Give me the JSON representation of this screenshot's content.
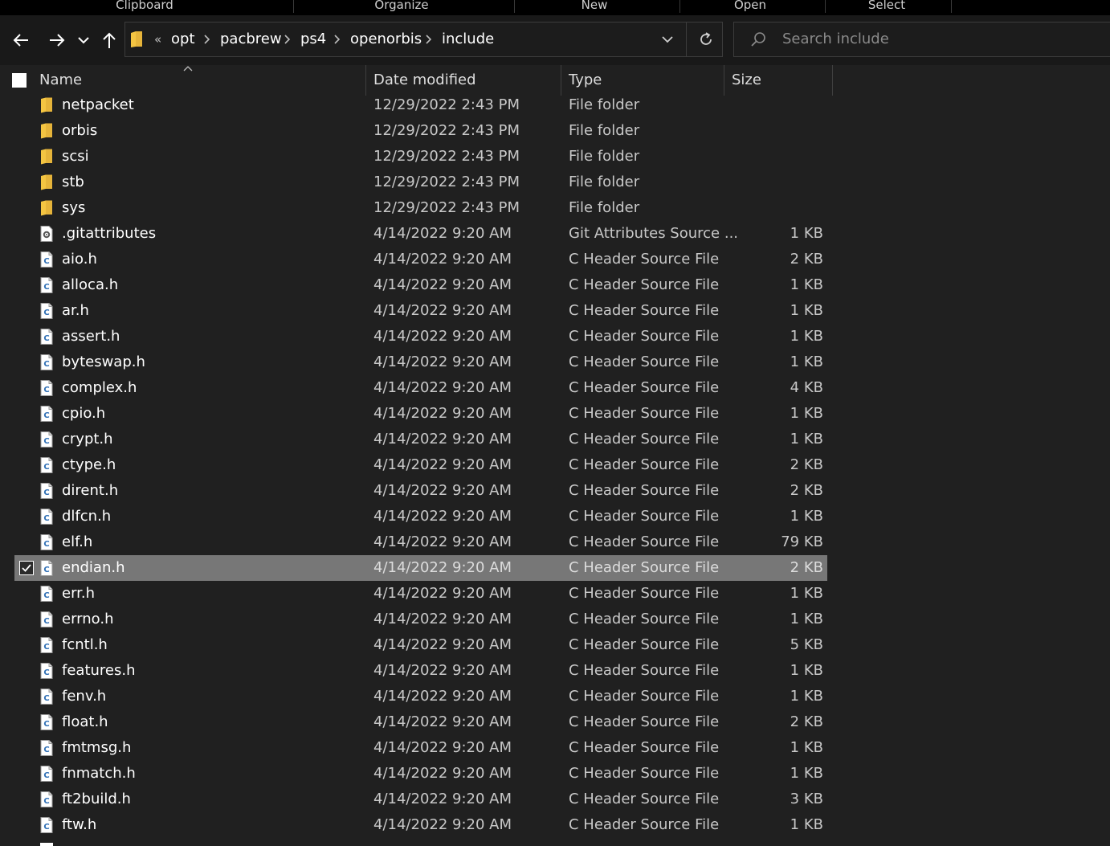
{
  "ribbon": {
    "groups": [
      "Clipboard",
      "Organize",
      "New",
      "Open",
      "Select"
    ]
  },
  "nav": {
    "back_icon": "arrow-left-icon",
    "forward_icon": "arrow-right-icon",
    "recent_icon": "chevron-down-icon",
    "up_icon": "arrow-up-icon",
    "path_overflow": "«",
    "path": [
      "opt",
      "pacbrew",
      "ps4",
      "openorbis",
      "include"
    ],
    "refresh_icon": "refresh-icon"
  },
  "search": {
    "placeholder": "Search include"
  },
  "columns": {
    "name": "Name",
    "date": "Date modified",
    "type": "Type",
    "size": "Size"
  },
  "colors": {
    "folder": "#f4c542",
    "selected_row": "#777777",
    "background": "#202020"
  },
  "files": [
    {
      "name": "netpacket",
      "date": "12/29/2022 2:43 PM",
      "type": "File folder",
      "size": "",
      "icon": "folder-icon",
      "selected": false
    },
    {
      "name": "orbis",
      "date": "12/29/2022 2:43 PM",
      "type": "File folder",
      "size": "",
      "icon": "folder-icon",
      "selected": false
    },
    {
      "name": "scsi",
      "date": "12/29/2022 2:43 PM",
      "type": "File folder",
      "size": "",
      "icon": "folder-icon",
      "selected": false
    },
    {
      "name": "stb",
      "date": "12/29/2022 2:43 PM",
      "type": "File folder",
      "size": "",
      "icon": "folder-icon",
      "selected": false
    },
    {
      "name": "sys",
      "date": "12/29/2022 2:43 PM",
      "type": "File folder",
      "size": "",
      "icon": "folder-icon",
      "selected": false
    },
    {
      "name": ".gitattributes",
      "date": "4/14/2022 9:20 AM",
      "type": "Git Attributes Source ...",
      "size": "1 KB",
      "icon": "gear-file-icon",
      "selected": false
    },
    {
      "name": "aio.h",
      "date": "4/14/2022 9:20 AM",
      "type": "C Header Source File",
      "size": "2 KB",
      "icon": "c-file-icon",
      "selected": false
    },
    {
      "name": "alloca.h",
      "date": "4/14/2022 9:20 AM",
      "type": "C Header Source File",
      "size": "1 KB",
      "icon": "c-file-icon",
      "selected": false
    },
    {
      "name": "ar.h",
      "date": "4/14/2022 9:20 AM",
      "type": "C Header Source File",
      "size": "1 KB",
      "icon": "c-file-icon",
      "selected": false
    },
    {
      "name": "assert.h",
      "date": "4/14/2022 9:20 AM",
      "type": "C Header Source File",
      "size": "1 KB",
      "icon": "c-file-icon",
      "selected": false
    },
    {
      "name": "byteswap.h",
      "date": "4/14/2022 9:20 AM",
      "type": "C Header Source File",
      "size": "1 KB",
      "icon": "c-file-icon",
      "selected": false
    },
    {
      "name": "complex.h",
      "date": "4/14/2022 9:20 AM",
      "type": "C Header Source File",
      "size": "4 KB",
      "icon": "c-file-icon",
      "selected": false
    },
    {
      "name": "cpio.h",
      "date": "4/14/2022 9:20 AM",
      "type": "C Header Source File",
      "size": "1 KB",
      "icon": "c-file-icon",
      "selected": false
    },
    {
      "name": "crypt.h",
      "date": "4/14/2022 9:20 AM",
      "type": "C Header Source File",
      "size": "1 KB",
      "icon": "c-file-icon",
      "selected": false
    },
    {
      "name": "ctype.h",
      "date": "4/14/2022 9:20 AM",
      "type": "C Header Source File",
      "size": "2 KB",
      "icon": "c-file-icon",
      "selected": false
    },
    {
      "name": "dirent.h",
      "date": "4/14/2022 9:20 AM",
      "type": "C Header Source File",
      "size": "2 KB",
      "icon": "c-file-icon",
      "selected": false
    },
    {
      "name": "dlfcn.h",
      "date": "4/14/2022 9:20 AM",
      "type": "C Header Source File",
      "size": "1 KB",
      "icon": "c-file-icon",
      "selected": false
    },
    {
      "name": "elf.h",
      "date": "4/14/2022 9:20 AM",
      "type": "C Header Source File",
      "size": "79 KB",
      "icon": "c-file-icon",
      "selected": false
    },
    {
      "name": "endian.h",
      "date": "4/14/2022 9:20 AM",
      "type": "C Header Source File",
      "size": "2 KB",
      "icon": "c-file-icon",
      "selected": true
    },
    {
      "name": "err.h",
      "date": "4/14/2022 9:20 AM",
      "type": "C Header Source File",
      "size": "1 KB",
      "icon": "c-file-icon",
      "selected": false
    },
    {
      "name": "errno.h",
      "date": "4/14/2022 9:20 AM",
      "type": "C Header Source File",
      "size": "1 KB",
      "icon": "c-file-icon",
      "selected": false
    },
    {
      "name": "fcntl.h",
      "date": "4/14/2022 9:20 AM",
      "type": "C Header Source File",
      "size": "5 KB",
      "icon": "c-file-icon",
      "selected": false
    },
    {
      "name": "features.h",
      "date": "4/14/2022 9:20 AM",
      "type": "C Header Source File",
      "size": "1 KB",
      "icon": "c-file-icon",
      "selected": false
    },
    {
      "name": "fenv.h",
      "date": "4/14/2022 9:20 AM",
      "type": "C Header Source File",
      "size": "1 KB",
      "icon": "c-file-icon",
      "selected": false
    },
    {
      "name": "float.h",
      "date": "4/14/2022 9:20 AM",
      "type": "C Header Source File",
      "size": "2 KB",
      "icon": "c-file-icon",
      "selected": false
    },
    {
      "name": "fmtmsg.h",
      "date": "4/14/2022 9:20 AM",
      "type": "C Header Source File",
      "size": "1 KB",
      "icon": "c-file-icon",
      "selected": false
    },
    {
      "name": "fnmatch.h",
      "date": "4/14/2022 9:20 AM",
      "type": "C Header Source File",
      "size": "1 KB",
      "icon": "c-file-icon",
      "selected": false
    },
    {
      "name": "ft2build.h",
      "date": "4/14/2022 9:20 AM",
      "type": "C Header Source File",
      "size": "3 KB",
      "icon": "c-file-icon",
      "selected": false
    },
    {
      "name": "ftw.h",
      "date": "4/14/2022 9:20 AM",
      "type": "C Header Source File",
      "size": "1 KB",
      "icon": "c-file-icon",
      "selected": false
    }
  ]
}
